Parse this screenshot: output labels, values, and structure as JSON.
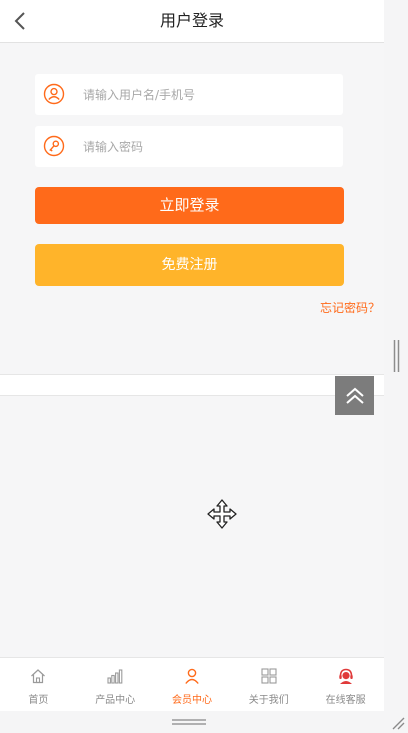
{
  "header": {
    "title": "用户登录",
    "back_icon": "chevron-left-icon"
  },
  "login_form": {
    "username": {
      "placeholder": "请输入用户名/手机号",
      "value": "",
      "icon": "user-icon"
    },
    "password": {
      "placeholder": "请输入密码",
      "value": "",
      "icon": "key-icon"
    },
    "login_label": "立即登录",
    "register_label": "免费注册",
    "forgot_label": "忘记密码？"
  },
  "tabbar": {
    "items": [
      {
        "label": "首页",
        "icon": "home-icon",
        "active": false
      },
      {
        "label": "产品中心",
        "icon": "bar-chart-icon",
        "active": false
      },
      {
        "label": "会员中心",
        "icon": "user-icon",
        "active": true
      },
      {
        "label": "关于我们",
        "icon": "grid-icon",
        "active": false
      },
      {
        "label": "在线客服",
        "icon": "customer-service-icon",
        "active": false
      }
    ]
  },
  "colors": {
    "accent": "#ff6a1a",
    "login_button": "#ff6a1a",
    "register_button": "#ffb42a",
    "back_to_top": "#7c7c7c",
    "page_background": "#f6f6f7"
  }
}
